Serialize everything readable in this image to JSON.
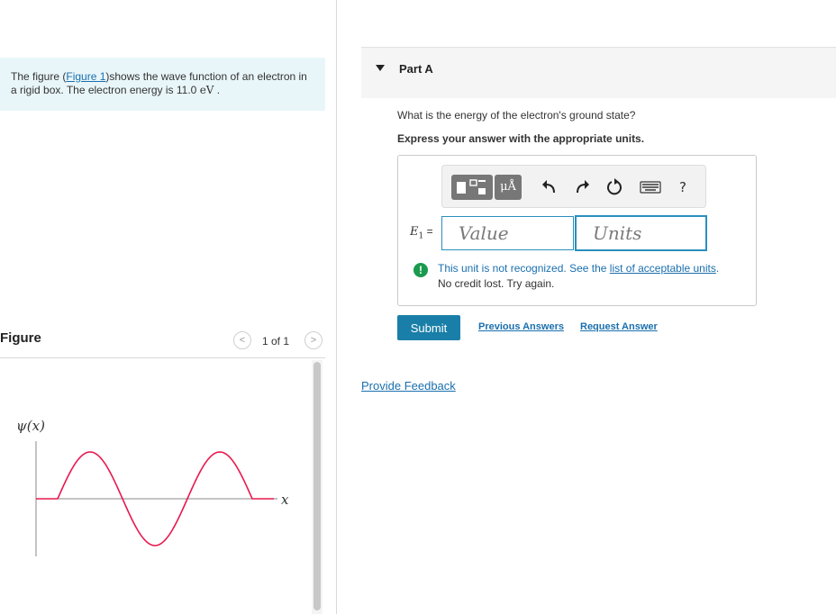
{
  "problem": {
    "text_before": "The figure (",
    "figure_link": "Figure 1",
    "text_after": ")shows the wave function of an electron in a rigid box. The electron energy is 11.0 ",
    "unit": "eV",
    "text_end": " ."
  },
  "figure": {
    "title": "Figure",
    "pager_count": "1 of 1",
    "prev_label": "<",
    "next_label": ">",
    "y_label": "ψ(x)",
    "x_label": "x",
    "wave_color": "#e8194f"
  },
  "part": {
    "title": "Part A",
    "question": "What is the energy of the electron's ground state?",
    "instruction": "Express your answer with the appropriate units."
  },
  "toolbar": {
    "units_label": "μÅ",
    "undo_icon": "undo-icon",
    "redo_icon": "redo-icon",
    "reset_icon": "reset-icon",
    "keyboard_icon": "keyboard-icon",
    "help_label": "?"
  },
  "answer": {
    "var_name": "E",
    "var_sub": "1",
    "var_eq": " =",
    "value_placeholder": "Value",
    "units_placeholder": "Units"
  },
  "feedback": {
    "icon": "!",
    "line1_text": "This unit is not recognized. See the ",
    "line1_link": "list of acceptable units",
    "line1_end": ".",
    "line2": "No credit lost. Try again."
  },
  "actions": {
    "submit": "Submit",
    "previous_answers": "Previous Answers",
    "request_answer": "Request Answer",
    "provide_feedback": "Provide Feedback"
  },
  "colors": {
    "accent": "#1a7fa8",
    "link": "#1a6fae",
    "success_icon": "#1a9a4c",
    "problem_bg": "#e9f6f9"
  }
}
